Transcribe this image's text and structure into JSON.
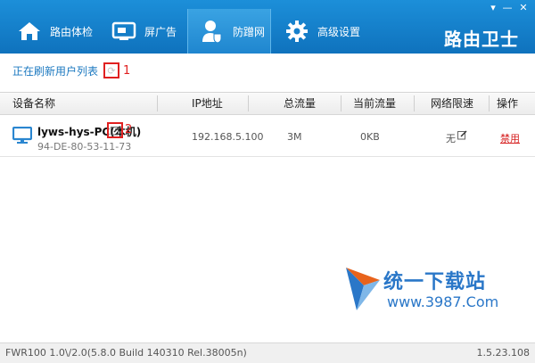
{
  "header": {
    "tabs": [
      {
        "label": "路由体检",
        "icon": "home-icon"
      },
      {
        "label": "屏广告",
        "icon": "ad-block-icon"
      },
      {
        "label": "防蹭网",
        "icon": "user-shield-icon"
      },
      {
        "label": "高级设置",
        "icon": "gear-icon"
      }
    ],
    "brand": "路由卫士",
    "window_controls": {
      "menu": "▾",
      "minimize": "—",
      "close": "✕"
    }
  },
  "status": {
    "text": "正在刷新用户列表",
    "marker": "1"
  },
  "table": {
    "columns": [
      "设备名称",
      "IP地址",
      "总流量",
      "当前流量",
      "网络限速",
      "操作"
    ],
    "rows": [
      {
        "name": "lyws-hys-PC(本机)",
        "mac": "94-DE-80-53-11-73",
        "ip": "192.168.5.100",
        "total": "3M",
        "current": "0KB",
        "limit": "无",
        "action": "禁用",
        "marker": "2"
      }
    ]
  },
  "watermark": {
    "text": "统一下载站",
    "url": "www.3987.Com"
  },
  "footer": {
    "version_left": "FWR100 1.0\\/2.0(5.8.0 Build 140310 Rel.38005n)",
    "version_right": "1.5.23.108"
  },
  "colors": {
    "header": "#1580cc",
    "accent_red": "#e02020",
    "link_blue": "#1c79c0"
  }
}
